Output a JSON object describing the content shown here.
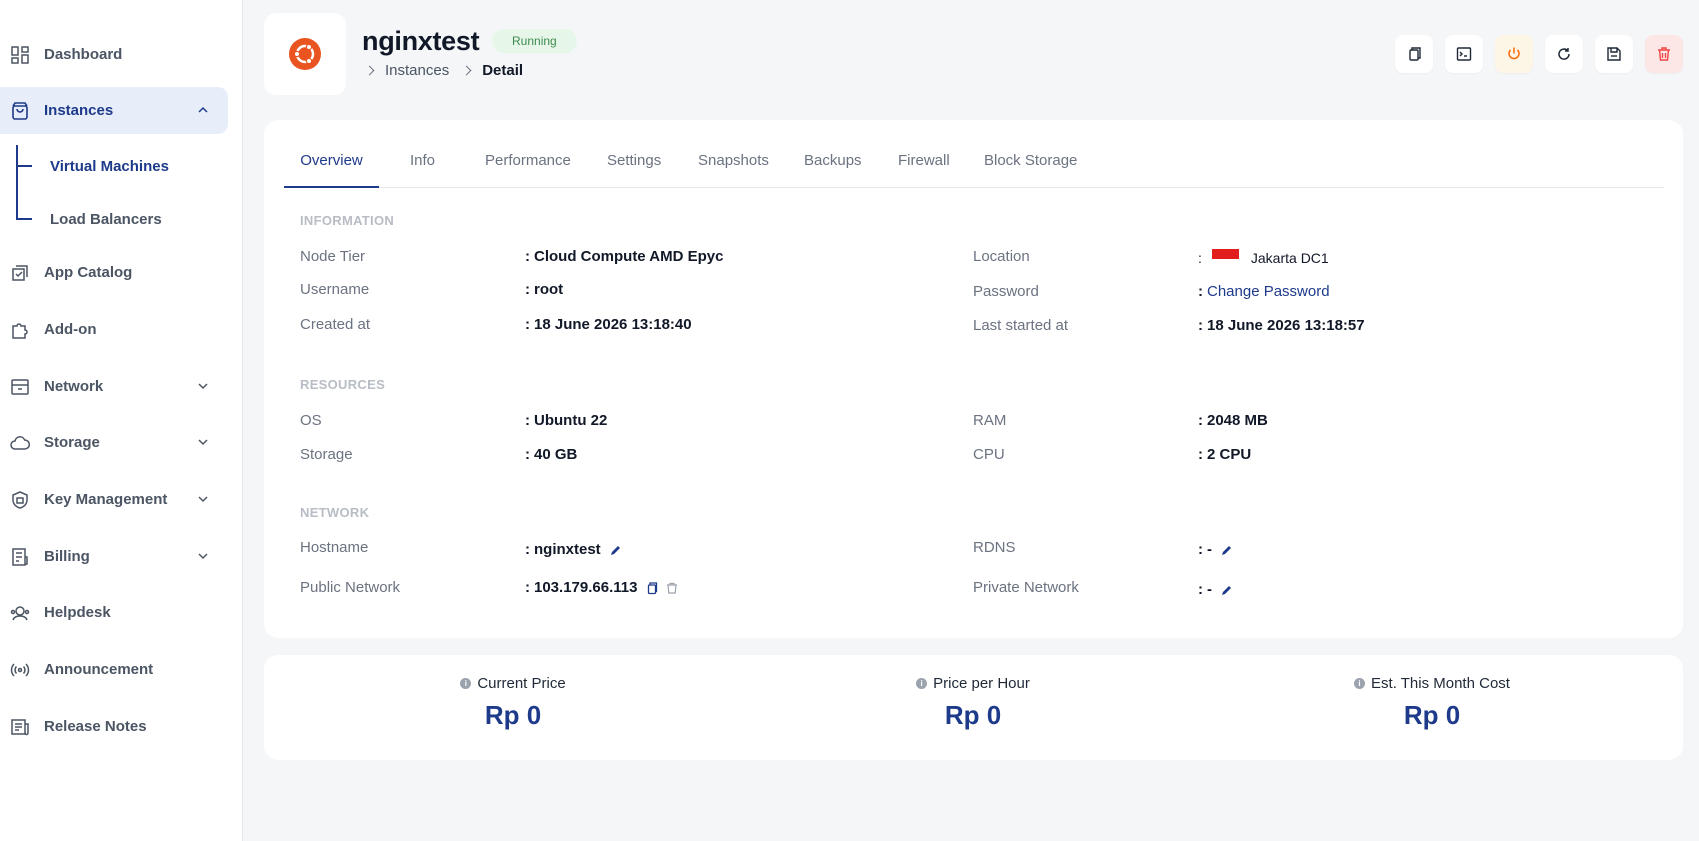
{
  "sidebar": {
    "items": [
      {
        "label": "Dashboard"
      },
      {
        "label": "Instances"
      },
      {
        "label": "App Catalog"
      },
      {
        "label": "Add-on"
      },
      {
        "label": "Network"
      },
      {
        "label": "Storage"
      },
      {
        "label": "Key Management"
      },
      {
        "label": "Billing"
      },
      {
        "label": "Helpdesk"
      },
      {
        "label": "Announcement"
      },
      {
        "label": "Release Notes"
      }
    ],
    "sub_items": [
      {
        "label": "Virtual Machines"
      },
      {
        "label": "Load Balancers"
      }
    ]
  },
  "header": {
    "title": "nginxtest",
    "status": "Running",
    "breadcrumb": [
      "Instances",
      "Detail"
    ]
  },
  "tabs": [
    "Overview",
    "Info",
    "Performance",
    "Settings",
    "Snapshots",
    "Backups",
    "Firewall",
    "Block Storage"
  ],
  "information": {
    "heading": "INFORMATION",
    "node_tier_label": "Node Tier",
    "node_tier_value": "Cloud Compute AMD Epyc",
    "username_label": "Username",
    "username_value": "root",
    "created_label": "Created at",
    "created_value": "18 June 2026 13:18:40",
    "location_label": "Location",
    "location_value": "Jakarta DC1",
    "password_label": "Password",
    "password_value": "Change Password",
    "last_started_label": "Last started at",
    "last_started_value": "18 June 2026 13:18:57"
  },
  "resources": {
    "heading": "RESOURCES",
    "os_label": "OS",
    "os_value": "Ubuntu 22",
    "storage_label": "Storage",
    "storage_value": "40 GB",
    "ram_label": "RAM",
    "ram_value": "2048 MB",
    "cpu_label": "CPU",
    "cpu_value": "2 CPU"
  },
  "network": {
    "heading": "NETWORK",
    "hostname_label": "Hostname",
    "hostname_value": "nginxtest",
    "public_label": "Public Network",
    "public_value": "103.179.66.113",
    "rdns_label": "RDNS",
    "rdns_value": "-",
    "private_label": "Private Network",
    "private_value": "-"
  },
  "colon": ":",
  "prices": [
    {
      "label": "Current Price",
      "value": "Rp 0"
    },
    {
      "label": "Price per Hour",
      "value": "Rp 0"
    },
    {
      "label": "Est. This Month Cost",
      "value": "Rp 0"
    }
  ],
  "colors": {
    "accent": "#1e3a8a",
    "running_bg": "#e6f7e9",
    "ubuntu": "#e95420",
    "danger": "#ef4444",
    "warning": "#f97316"
  }
}
